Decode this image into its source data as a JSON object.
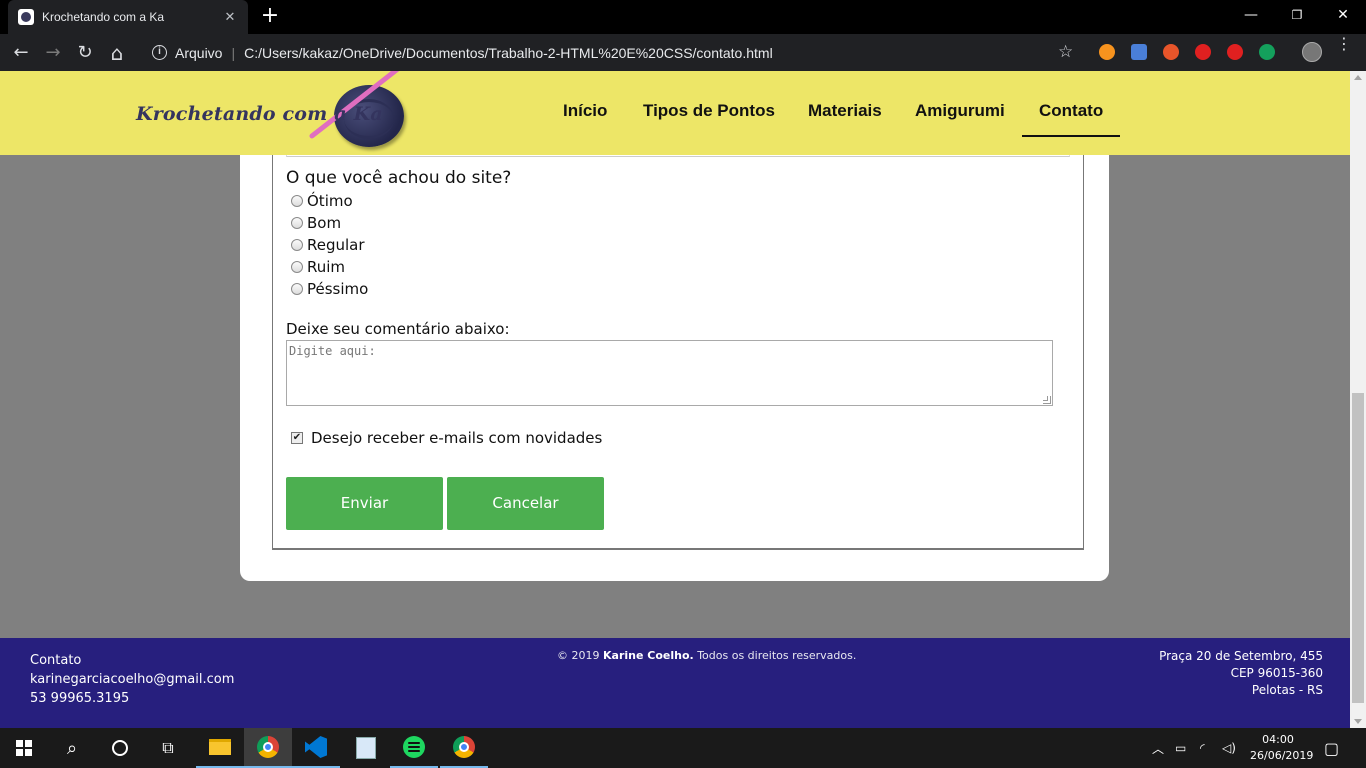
{
  "browser": {
    "tab_title": "Krochetando com a Ka",
    "tab_close": "✕",
    "new_tab": "+",
    "window_controls": {
      "minimize": "—",
      "maximize": "❐",
      "close": "✕"
    },
    "nav": {
      "back": "←",
      "forward": "→",
      "reload": "↻",
      "home": "⌂"
    },
    "address": {
      "security_label": "Arquivo",
      "separator": "|",
      "url": "C:/Users/kakaz/OneDrive/Documentos/Trabalho-2-HTML%20E%20CSS/contato.html"
    },
    "star": "☆",
    "menu": "⋮",
    "extension_colors": [
      "#f7931e",
      "#4a7fd8",
      "#e8552a",
      "#e02020",
      "#e02020",
      "#14a05c"
    ]
  },
  "site": {
    "logo_text": "Krochetando com a Ka",
    "nav_items": [
      {
        "label": "Início"
      },
      {
        "label": "Tipos de Pontos"
      },
      {
        "label": "Materiais"
      },
      {
        "label": "Amigurumi"
      },
      {
        "label": "Contato",
        "active": true
      }
    ],
    "header_color": "#ede667"
  },
  "form": {
    "rating_question": "O que você achou do site?",
    "rating_options": [
      "Ótimo",
      "Bom",
      "Regular",
      "Ruim",
      "Péssimo"
    ],
    "comment_label": "Deixe seu comentário abaixo:",
    "comment_placeholder": "Digite aqui:",
    "newsletter_label": "Desejo receber e-mails com novidades",
    "newsletter_checked": true,
    "submit_label": "Enviar",
    "cancel_label": "Cancelar",
    "button_color": "#4caf50"
  },
  "footer": {
    "contact_title": "Contato",
    "email": "karinegarciacoelho@gmail.com",
    "phone": "53 99965.3195",
    "copyright_prefix": "© 2019",
    "copyright_name": "Karine Coelho.",
    "copyright_suffix": "Todos os direitos reservados.",
    "address_line1": "Praça 20 de Setembro, 455",
    "address_line2": "CEP 96015-360",
    "address_line3": "Pelotas - RS",
    "background": "#271f7e"
  },
  "taskbar": {
    "time": "04:00",
    "date": "26/06/2019",
    "apps": [
      "start",
      "search",
      "cortana",
      "task-view",
      "file-explorer",
      "chrome",
      "vscode",
      "paint",
      "spotify",
      "chrome"
    ]
  }
}
